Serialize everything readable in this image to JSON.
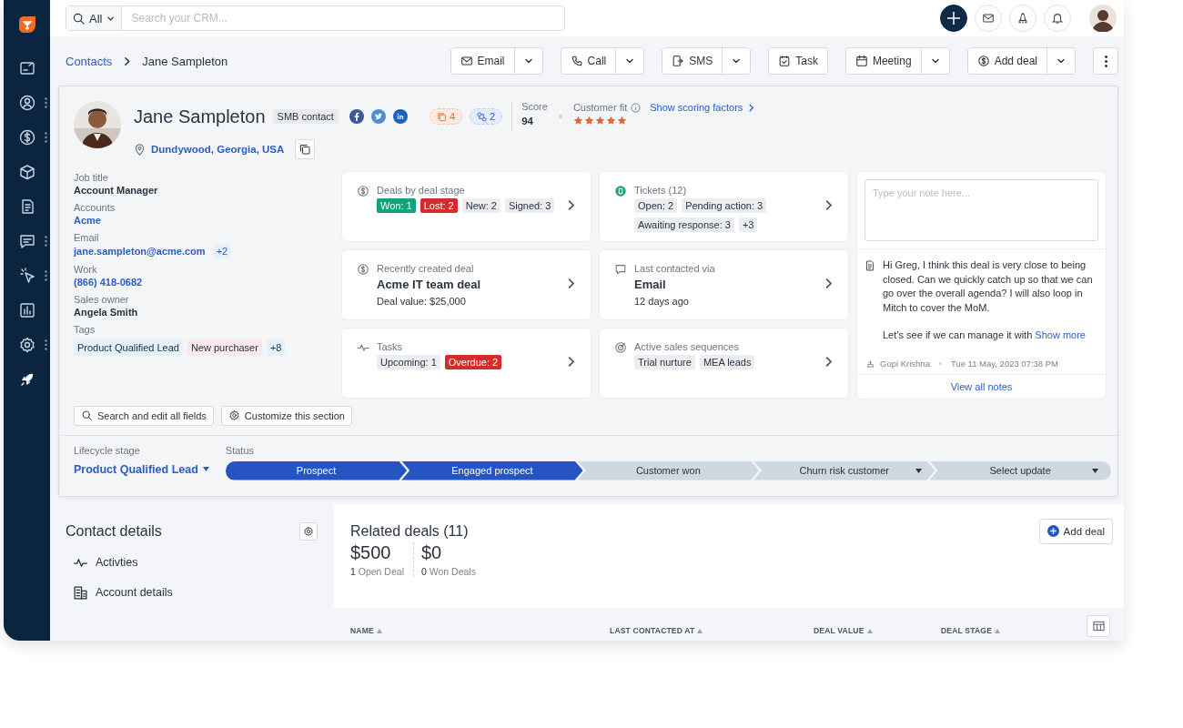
{
  "search": {
    "scope": "All",
    "placeholder": "Search your CRM..."
  },
  "breadcrumb": {
    "parent": "Contacts",
    "current": "Jane Sampleton"
  },
  "actions": [
    {
      "label": "Email",
      "kind": "mail",
      "dropdown": true
    },
    {
      "label": "Call",
      "kind": "phone",
      "dropdown": true
    },
    {
      "label": "SMS",
      "kind": "sms",
      "dropdown": true
    },
    {
      "label": "Task",
      "kind": "task",
      "dropdown": false
    },
    {
      "label": "Meeting",
      "kind": "calendar",
      "dropdown": true
    },
    {
      "label": "Add deal",
      "kind": "dollar",
      "dropdown": true
    }
  ],
  "contact": {
    "name": "Jane Sampleton",
    "segment": "SMB contact",
    "location": "Dundywood, Georgia, USA",
    "badges": [
      {
        "kind": "tasks",
        "count": "4"
      },
      {
        "kind": "links",
        "count": "2"
      }
    ],
    "score_label": "Score",
    "score": "94",
    "fit_label": "Customer fit",
    "stars": 5,
    "scoring_link": "Show scoring factors"
  },
  "fields": [
    {
      "label": "Job title",
      "value": "Account Manager",
      "kind": "text"
    },
    {
      "label": "Accounts",
      "value": "Acme",
      "kind": "link"
    },
    {
      "label": "Email",
      "value": "jane.sampleton@acme.com",
      "kind": "link",
      "extra": "+2"
    },
    {
      "label": "Work",
      "value": "(866) 418-0682",
      "kind": "link"
    },
    {
      "label": "Sales owner",
      "value": "Angela Smith",
      "kind": "text"
    }
  ],
  "tags": {
    "label": "Tags",
    "items": [
      {
        "text": "Product Qualified Lead",
        "color": "#e3f1fb"
      },
      {
        "text": "New purchaser",
        "color": "#fbe9e9"
      },
      {
        "text": "+8",
        "color": "#e3f1fb"
      }
    ]
  },
  "cards": [
    {
      "kind": "dollar",
      "title": "Deals by deal stage",
      "chips": [
        {
          "text": "Won: 1",
          "kind": "success"
        },
        {
          "text": "Lost: 2",
          "kind": "danger"
        },
        {
          "text": "New: 2",
          "kind": "neutral"
        },
        {
          "text": "Signed: 3",
          "kind": "neutral"
        }
      ]
    },
    {
      "kind": "ticket",
      "title": "Tickets (12)",
      "chips": [
        {
          "text": "Open: 2",
          "kind": "neutral"
        },
        {
          "text": "Pending action: 3",
          "kind": "neutral"
        },
        {
          "text": "Awaiting response: 3",
          "kind": "neutral"
        },
        {
          "text": "+3",
          "kind": "neutral"
        }
      ]
    },
    {
      "kind": "dollar",
      "title": "Recently created deal",
      "headline": "Acme IT team deal",
      "detail": "Deal value: $25,000"
    },
    {
      "kind": "chat",
      "title": "Last contacted via",
      "headline": "Email",
      "detail": "12 days ago"
    },
    {
      "kind": "pulse",
      "title": "Tasks",
      "chips": [
        {
          "text": "Upcoming: 1",
          "kind": "neutral"
        },
        {
          "text": "Overdue: 2",
          "kind": "danger"
        }
      ]
    },
    {
      "kind": "target",
      "title": "Active sales sequences",
      "chips": [
        {
          "text": "Trial nurture",
          "kind": "neutral"
        },
        {
          "text": "MEA leads",
          "kind": "neutral"
        }
      ]
    }
  ],
  "notes": {
    "placeholder": "Type your note here...",
    "body": "Hi Greg, I think this deal is very close to being closed. Can we quickly catch up so that we can go over the overall agenda? I will also loop in Mitch to cover the MoM.",
    "body_end": "Let’s see if we can manage it with",
    "more": "Show more",
    "author": "Gopi Krishna",
    "time": "Tue 11 May, 2023 07:38 PM",
    "view_all": "View all notes"
  },
  "section_buttons": [
    {
      "label": "Search and edit all fields",
      "kind": "search"
    },
    {
      "label": "Customize this section",
      "kind": "gear"
    }
  ],
  "lifecycle": {
    "label": "Lifecycle stage",
    "value": "Product Qualified Lead",
    "status_label": "Status",
    "stages": [
      {
        "label": "Prospect",
        "completed": true,
        "dropdown": false
      },
      {
        "label": "Engaged prospect",
        "completed": true,
        "dropdown": false
      },
      {
        "label": "Customer won",
        "completed": false,
        "dropdown": false
      },
      {
        "label": "Churn risk customer",
        "completed": false,
        "dropdown": true
      },
      {
        "label": "Select update",
        "completed": false,
        "dropdown": true
      }
    ]
  },
  "contact_details": {
    "title": "Contact details",
    "items": [
      {
        "label": "Activties",
        "kind": "pulse"
      },
      {
        "label": "Account details",
        "kind": "building"
      }
    ]
  },
  "related_deals": {
    "title": "Related deals (11)",
    "add": "Add deal",
    "stats": [
      {
        "amount": "$500",
        "count": "1",
        "label": "Open Deal"
      },
      {
        "amount": "$0",
        "count": "0",
        "label": "Won Deals"
      }
    ],
    "columns": [
      "NAME",
      "LAST CONTACTED AT",
      "DEAL VALUE",
      "DEAL STAGE"
    ]
  }
}
